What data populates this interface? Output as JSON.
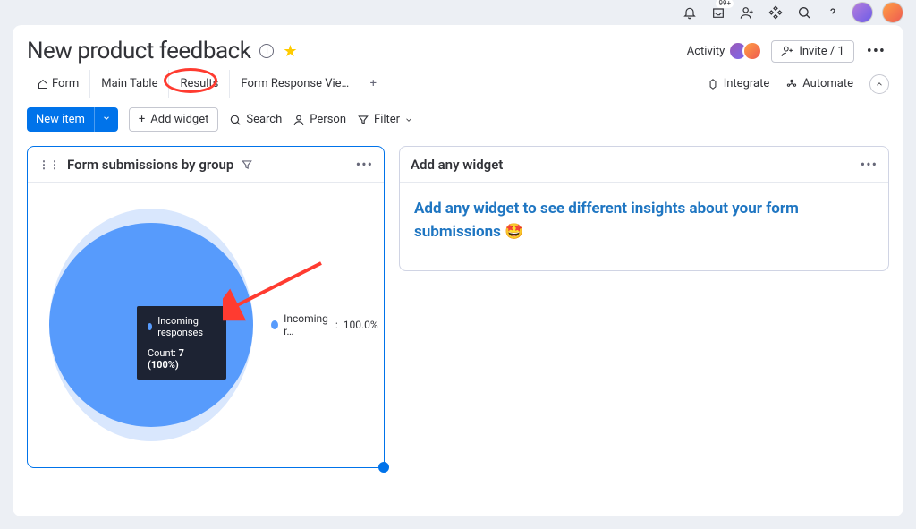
{
  "topbar": {
    "badge": "99+"
  },
  "header": {
    "title": "New product feedback",
    "activity_label": "Activity",
    "invite_label": "Invite / 1"
  },
  "tabs": {
    "items": [
      {
        "label": "Form"
      },
      {
        "label": "Main Table"
      },
      {
        "label": "Results"
      },
      {
        "label": "Form Response Vie…"
      }
    ],
    "integrate": "Integrate",
    "automate": "Automate"
  },
  "toolbar": {
    "new_item": "New item",
    "add_widget": "Add widget",
    "search": "Search",
    "person": "Person",
    "filter": "Filter"
  },
  "widget1": {
    "title": "Form submissions by group",
    "legend_label": "Incoming r…",
    "legend_separator": ":",
    "legend_value": "100.0%",
    "tooltip_label": "Incoming responses",
    "tooltip_count_label": "Count:",
    "tooltip_count_value": "7 (100%)"
  },
  "widget2": {
    "title": "Add any widget",
    "body": "Add any widget to see different insights about your form submissions 🤩"
  },
  "chart_data": {
    "type": "pie",
    "title": "Form submissions by group",
    "series": [
      {
        "name": "Incoming responses",
        "value": 7,
        "percent": 100.0,
        "color": "#579bfc"
      }
    ]
  }
}
